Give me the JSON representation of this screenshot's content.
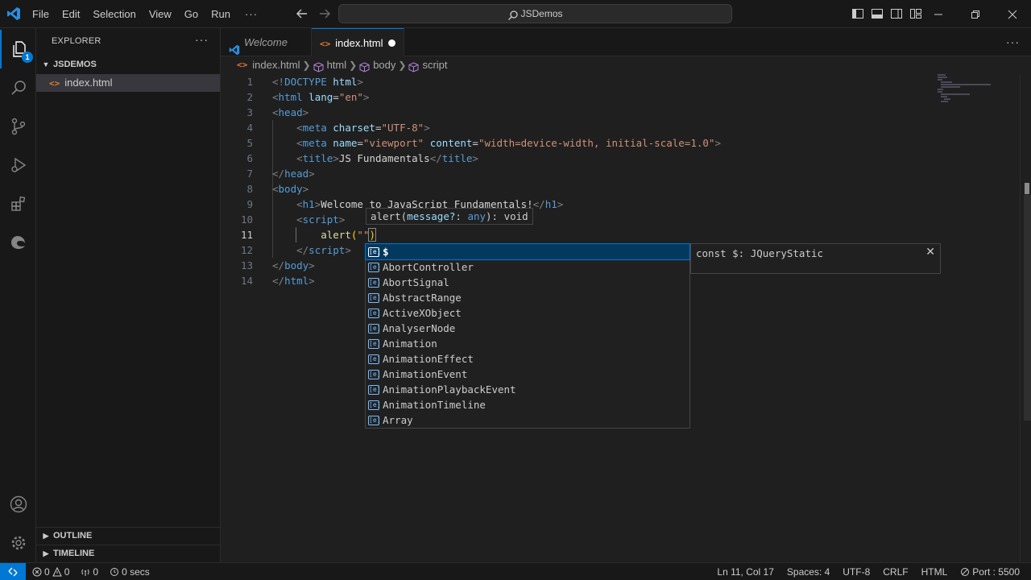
{
  "titlebar": {
    "menu": [
      "File",
      "Edit",
      "Selection",
      "View",
      "Go",
      "Run",
      "···"
    ],
    "search_text": "JSDemos"
  },
  "sidebar": {
    "header": "EXPLORER",
    "more": "···",
    "folder": "JSDEMOS",
    "file": "index.html",
    "outline": "OUTLINE",
    "timeline": "TIMELINE"
  },
  "activity": {
    "badge": "1"
  },
  "tabs": {
    "welcome": "Welcome",
    "active": "index.html",
    "more": "···"
  },
  "breadcrumb": [
    "index.html",
    "html",
    "body",
    "script"
  ],
  "editor": {
    "line_numbers": [
      "1",
      "2",
      "3",
      "4",
      "5",
      "6",
      "7",
      "8",
      "9",
      "10",
      "11",
      "12",
      "13",
      "14"
    ],
    "current_line": 11
  },
  "hint": {
    "fn": "alert",
    "param": "message?",
    "type": "any",
    "ret": "void"
  },
  "suggest": {
    "items": [
      "$",
      "AbortController",
      "AbortSignal",
      "AbstractRange",
      "ActiveXObject",
      "AnalyserNode",
      "Animation",
      "AnimationEffect",
      "AnimationEvent",
      "AnimationPlaybackEvent",
      "AnimationTimeline",
      "Array"
    ],
    "detail": "const $: JQueryStatic"
  },
  "statusbar": {
    "errors": "0",
    "warnings": "0",
    "ports_count": "0",
    "timer": "0 secs",
    "position": "Ln 11, Col 17",
    "spaces": "Spaces: 4",
    "encoding": "UTF-8",
    "eol": "CRLF",
    "language": "HTML",
    "port": "Port : 5500"
  },
  "colors": {
    "accent": "#0078d4",
    "tag": "#569cd6",
    "attr": "#9cdcfe",
    "string": "#ce9178",
    "function": "#dcdcaa"
  }
}
